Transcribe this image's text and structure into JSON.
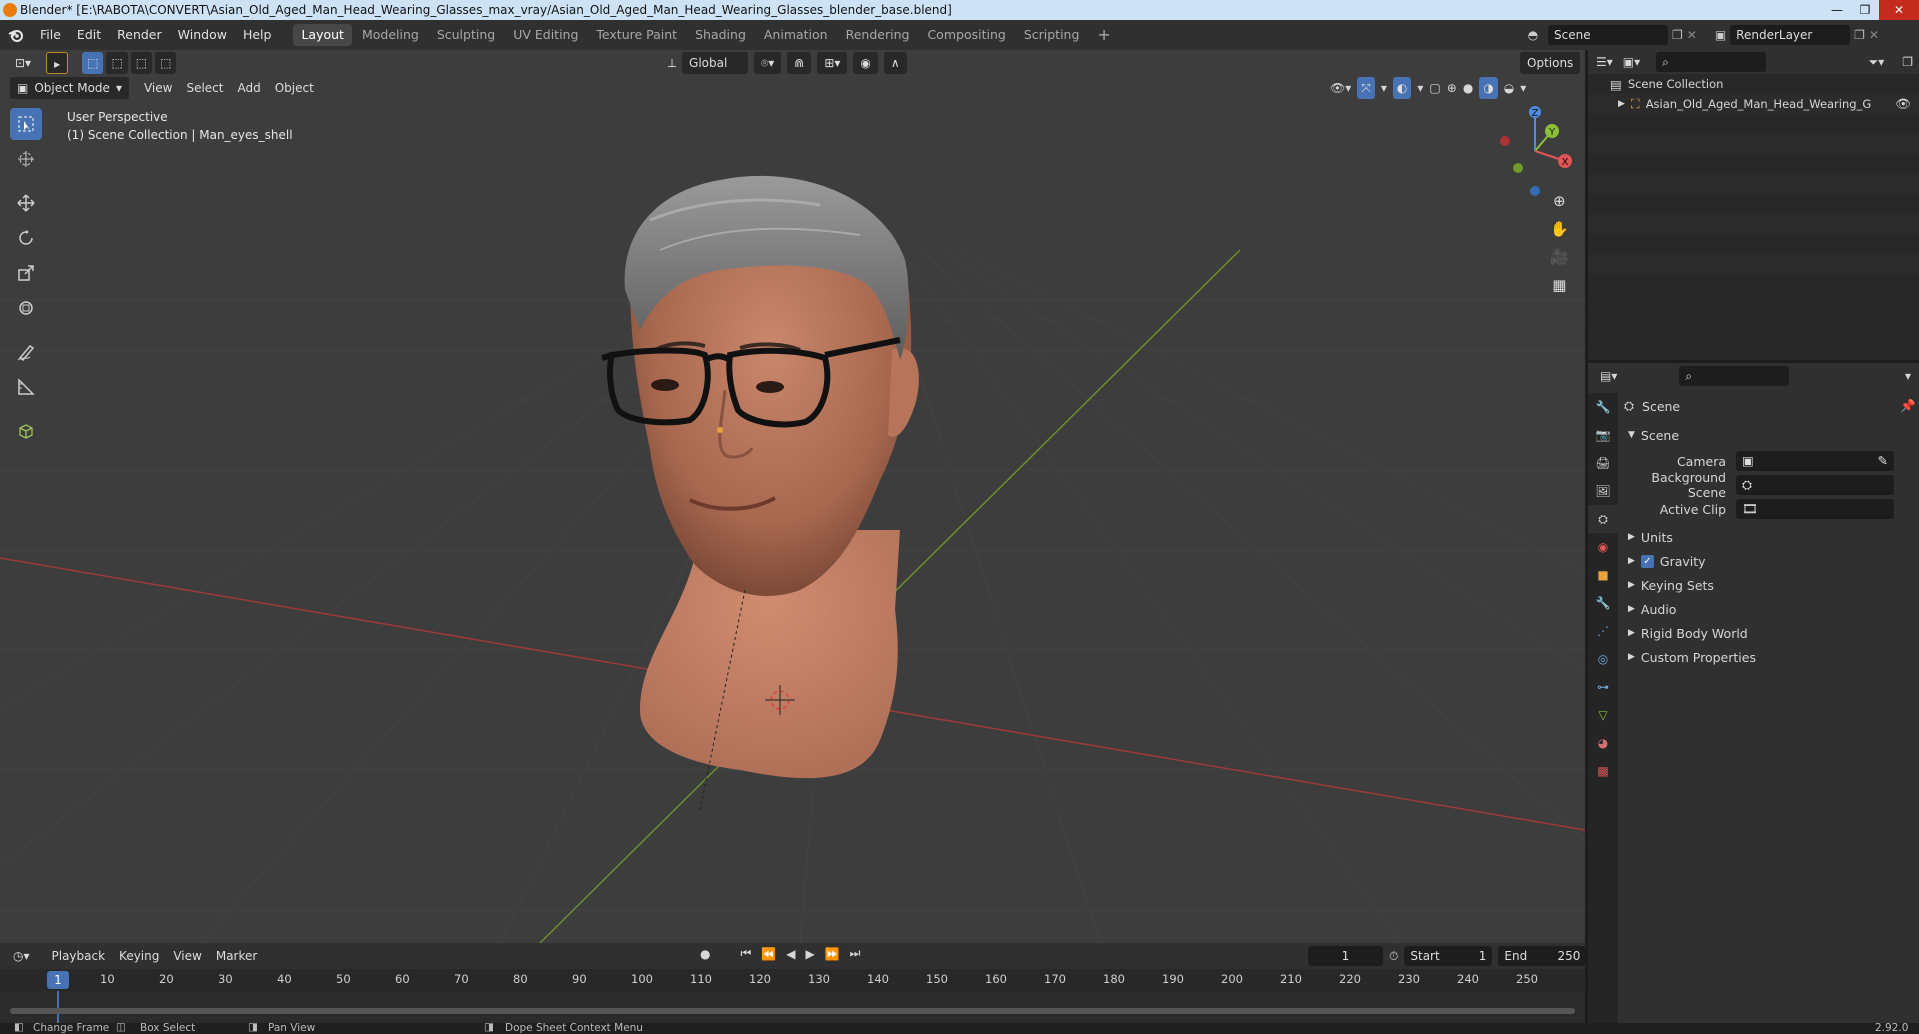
{
  "window": {
    "title": "Blender* [E:\\RABOTA\\CONVERT\\Asian_Old_Aged_Man_Head_Wearing_Glasses_max_vray/Asian_Old_Aged_Man_Head_Wearing_Glasses_blender_base.blend]",
    "controls": [
      "—",
      "❐",
      "✕"
    ]
  },
  "menu": [
    "File",
    "Edit",
    "Render",
    "Window",
    "Help"
  ],
  "workspaces": [
    "Layout",
    "Modeling",
    "Sculpting",
    "UV Editing",
    "Texture Paint",
    "Shading",
    "Animation",
    "Rendering",
    "Compositing",
    "Scripting"
  ],
  "active_workspace": "Layout",
  "scene_field": "Scene",
  "render_layer_field": "RenderLayer",
  "viewport": {
    "mode": "Object Mode",
    "menus": [
      "View",
      "Select",
      "Add",
      "Object"
    ],
    "orientation": "Global",
    "options_label": "Options",
    "info_line1": "User Perspective",
    "info_line2": "(1) Scene Collection | Man_eyes_shell",
    "gizmo": {
      "x": "X",
      "y": "Y",
      "z": "Z"
    }
  },
  "outliner": {
    "root": "Scene Collection",
    "item": "Asian_Old_Aged_Man_Head_Wearing_Glasse"
  },
  "properties": {
    "context": "Scene",
    "section": "Scene",
    "fields": [
      {
        "label": "Camera",
        "value": ""
      },
      {
        "label": "Background Scene",
        "value": ""
      },
      {
        "label": "Active Clip",
        "value": ""
      }
    ],
    "subpanels": [
      "Units",
      "Gravity",
      "Keying Sets",
      "Audio",
      "Rigid Body World",
      "Custom Properties"
    ],
    "gravity_checked": true
  },
  "timeline": {
    "menus": [
      "Playback",
      "Keying",
      "View",
      "Marker"
    ],
    "current_frame": "1",
    "start_label": "Start",
    "start": "1",
    "end_label": "End",
    "end": "250",
    "ruler": [
      "10",
      "20",
      "30",
      "40",
      "50",
      "60",
      "70",
      "80",
      "90",
      "100",
      "110",
      "120",
      "130",
      "140",
      "150",
      "160",
      "170",
      "180",
      "190",
      "200",
      "210",
      "220",
      "230",
      "240",
      "250"
    ],
    "playhead": "1"
  },
  "statusbar": {
    "items": [
      "Change Frame",
      "Box Select",
      "Pan View",
      "Dope Sheet Context Menu"
    ],
    "version": "2.92.0"
  }
}
